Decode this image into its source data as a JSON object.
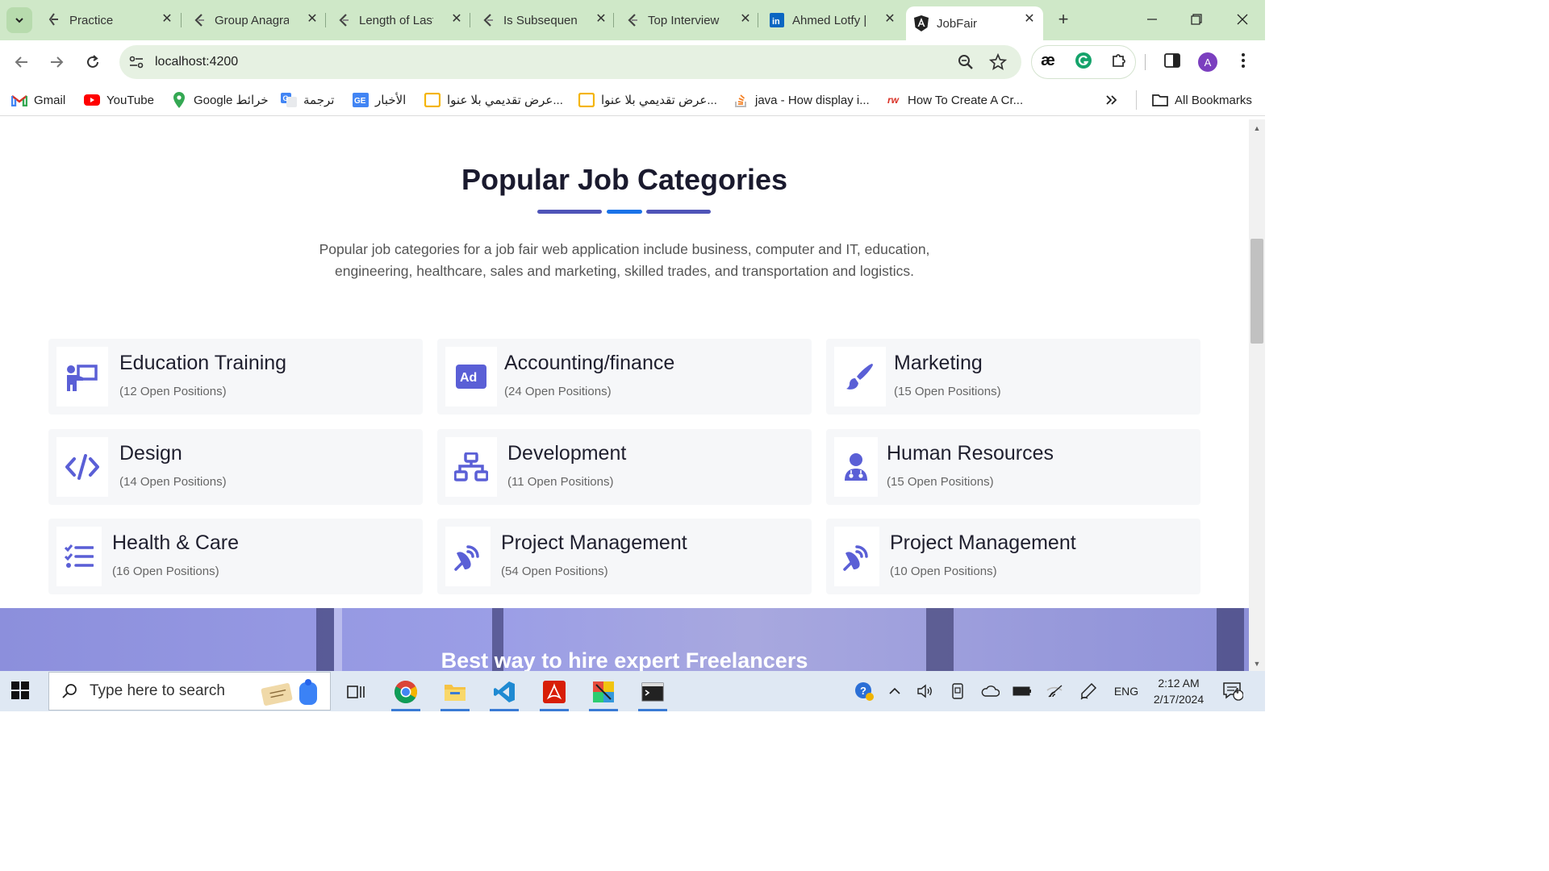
{
  "browser": {
    "tabs": [
      {
        "title": "Practice",
        "icon": "leetcode-icon"
      },
      {
        "title": "Group Anagra",
        "icon": "leetcode-icon"
      },
      {
        "title": "Length of Last",
        "icon": "leetcode-icon"
      },
      {
        "title": "Is Subsequenc",
        "icon": "leetcode-icon"
      },
      {
        "title": "Top Interview",
        "icon": "leetcode-icon"
      },
      {
        "title": "Ahmed Lotfy |",
        "icon": "linkedin-icon"
      },
      {
        "title": "JobFair",
        "icon": "angular-icon"
      }
    ],
    "address": "localhost:4200",
    "bookmarks": [
      {
        "label": "Gmail"
      },
      {
        "label": "YouTube"
      },
      {
        "label": "Google خرائط"
      },
      {
        "label": "ترجمة"
      },
      {
        "label": "الأخبار"
      },
      {
        "label": "عرض تقديمي بلا عنوا..."
      },
      {
        "label": "عرض تقديمي بلا عنوا..."
      },
      {
        "label": "java - How display i..."
      },
      {
        "label": "How To Create A Cr..."
      }
    ],
    "all_bookmarks": "All Bookmarks",
    "profile_initial": "A",
    "ext_label": "æ"
  },
  "section": {
    "title": "Popular Job Categories",
    "description": "Popular job categories for a job fair web application include business, computer and IT, education, engineering, healthcare, sales and marketing, skilled trades, and transportation and logistics."
  },
  "categories": [
    {
      "title": "Education Training",
      "subtitle": "(12 Open Positions)",
      "icon": "presenter-icon"
    },
    {
      "title": "Accounting/finance",
      "subtitle": "(24 Open Positions)",
      "icon": "ad-icon"
    },
    {
      "title": "Marketing",
      "subtitle": "(15 Open Positions)",
      "icon": "paintbrush-icon"
    },
    {
      "title": "Design",
      "subtitle": "(14 Open Positions)",
      "icon": "code-icon"
    },
    {
      "title": "Development",
      "subtitle": "(11 Open Positions)",
      "icon": "sitemap-icon"
    },
    {
      "title": "Human Resources",
      "subtitle": "(15 Open Positions)",
      "icon": "user-doctor-icon"
    },
    {
      "title": "Health & Care",
      "subtitle": "(16 Open Positions)",
      "icon": "list-check-icon"
    },
    {
      "title": "Project Management",
      "subtitle": "(54 Open Positions)",
      "icon": "satellite-dish-icon"
    },
    {
      "title": "Project Management",
      "subtitle": "(10 Open Positions)",
      "icon": "satellite-dish-icon"
    }
  ],
  "hero": {
    "text": "Best way to hire expert Freelancers"
  },
  "taskbar": {
    "search_placeholder": "Type here to search",
    "language": "ENG",
    "time": "2:12 AM",
    "date": "2/17/2024",
    "notification_count": "4"
  },
  "colors": {
    "accent": "#5a5fd6",
    "title_bar_dark": "#4f54b8",
    "title_bar_blue": "#1a73e8",
    "tab_strip": "#cfe8c8"
  }
}
